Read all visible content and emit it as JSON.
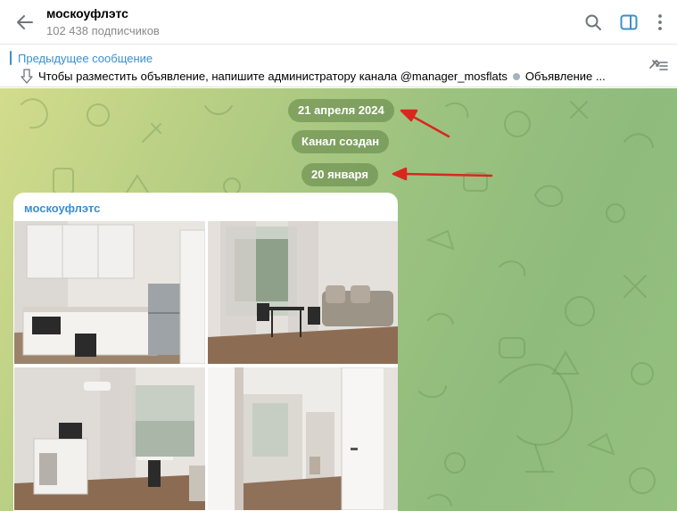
{
  "header": {
    "channel_name": "москоуфлэтс",
    "subscribers": "102 438 подписчиков"
  },
  "pinned": {
    "title": "Предыдущее сообщение",
    "text_main": "Чтобы разместить объявление, напишите администратору канала @manager_mosflats",
    "text_next": "Объявление ..."
  },
  "chat": {
    "date_pill_1": "21 апреля 2024",
    "service_channel_created": "Канал создан",
    "date_pill_2": "20 января",
    "message": {
      "author": "москоуфлэтс",
      "photos": [
        "kitchen-photo",
        "living-room-photo",
        "bedroom-photo",
        "doorway-photo"
      ]
    }
  },
  "colors": {
    "accent_blue": "#3a8fd1",
    "annotation_red": "#d9271e",
    "pill_bg": "rgba(95,130,70,0.55)"
  },
  "icons": {
    "back": "arrow-left-icon",
    "search": "search-icon",
    "sidebar": "sidebar-toggle-icon",
    "menu": "more-vertical-icon",
    "pinned_list": "pinned-list-icon",
    "pinned_arrow": "arrow-down-icon"
  }
}
